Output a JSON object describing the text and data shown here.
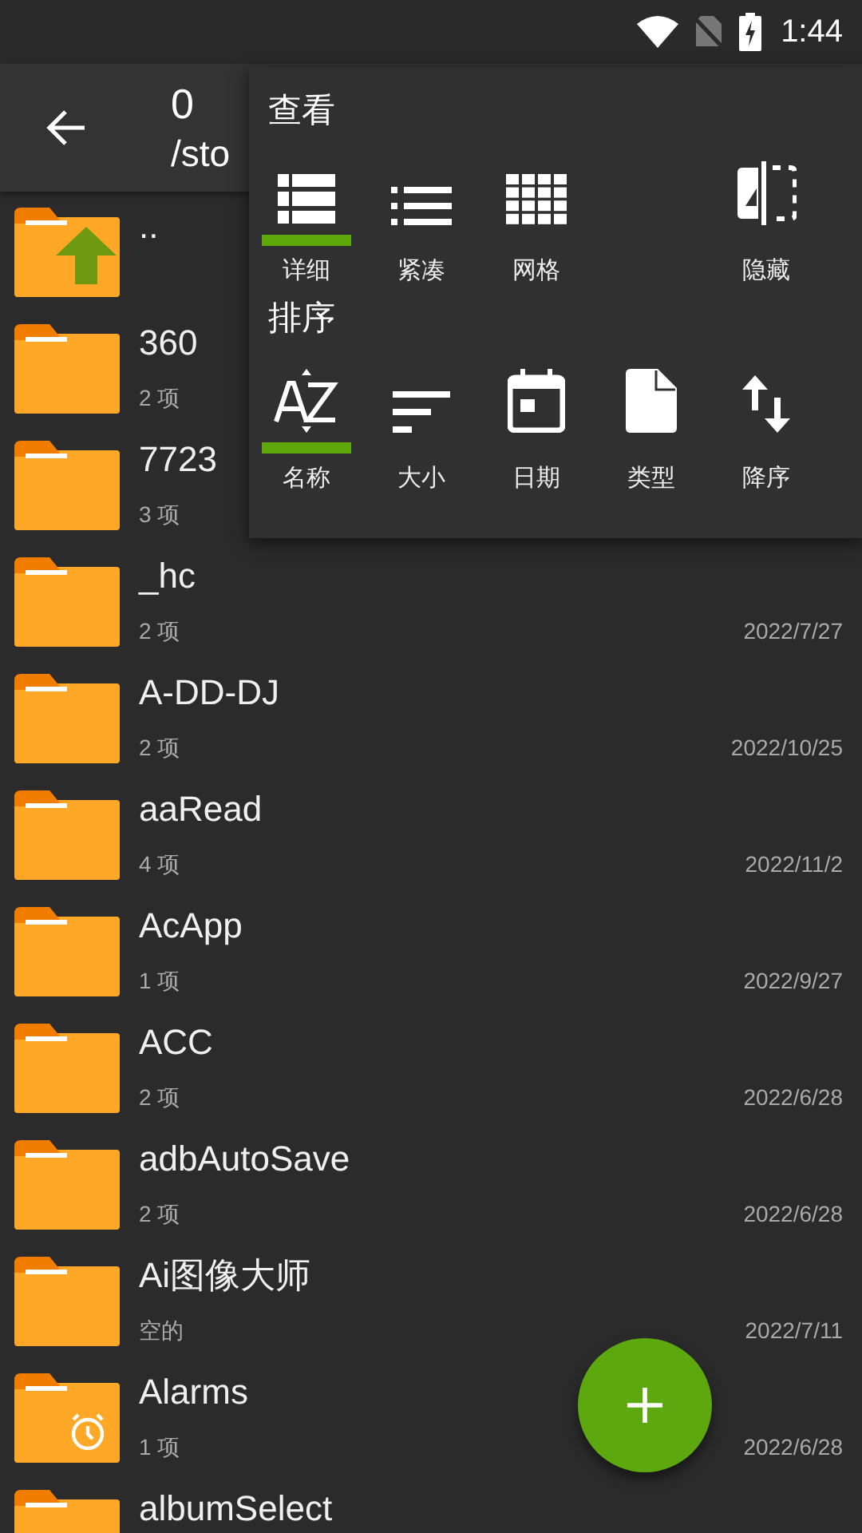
{
  "status_bar": {
    "time": "1:44"
  },
  "app_bar": {
    "title": "0",
    "path": "/sto"
  },
  "menu": {
    "view_title": "查看",
    "view_items": [
      {
        "label": "详细",
        "selected": true
      },
      {
        "label": "紧凑",
        "selected": false
      },
      {
        "label": "网格",
        "selected": false
      },
      {
        "label": "隐藏",
        "selected": false
      }
    ],
    "sort_title": "排序",
    "sort_items": [
      {
        "label": "名称",
        "selected": true
      },
      {
        "label": "大小",
        "selected": false
      },
      {
        "label": "日期",
        "selected": false
      },
      {
        "label": "类型",
        "selected": false
      },
      {
        "label": "降序",
        "selected": false
      }
    ]
  },
  "files": [
    {
      "kind": "up",
      "name": ".."
    },
    {
      "kind": "folder",
      "name": "360",
      "count": "2 项"
    },
    {
      "kind": "folder",
      "name": "7723",
      "count": "3 项"
    },
    {
      "kind": "folder",
      "name": "_hc",
      "count": "2 项",
      "date": "2022/7/27"
    },
    {
      "kind": "folder",
      "name": "A-DD-DJ",
      "count": "2 项",
      "date": "2022/10/25"
    },
    {
      "kind": "folder",
      "name": "aaRead",
      "count": "4 项",
      "date": "2022/11/2"
    },
    {
      "kind": "folder",
      "name": "AcApp",
      "count": "1 项",
      "date": "2022/9/27"
    },
    {
      "kind": "folder",
      "name": "ACC",
      "count": "2 项",
      "date": "2022/6/28"
    },
    {
      "kind": "folder",
      "name": "adbAutoSave",
      "count": "2 项",
      "date": "2022/6/28"
    },
    {
      "kind": "folder",
      "name": "Ai图像大师",
      "count": "空的",
      "date": "2022/7/11"
    },
    {
      "kind": "alarm",
      "name": "Alarms",
      "count": "1 项",
      "date": "2022/6/28"
    },
    {
      "kind": "folder",
      "name": "albumSelect"
    }
  ]
}
